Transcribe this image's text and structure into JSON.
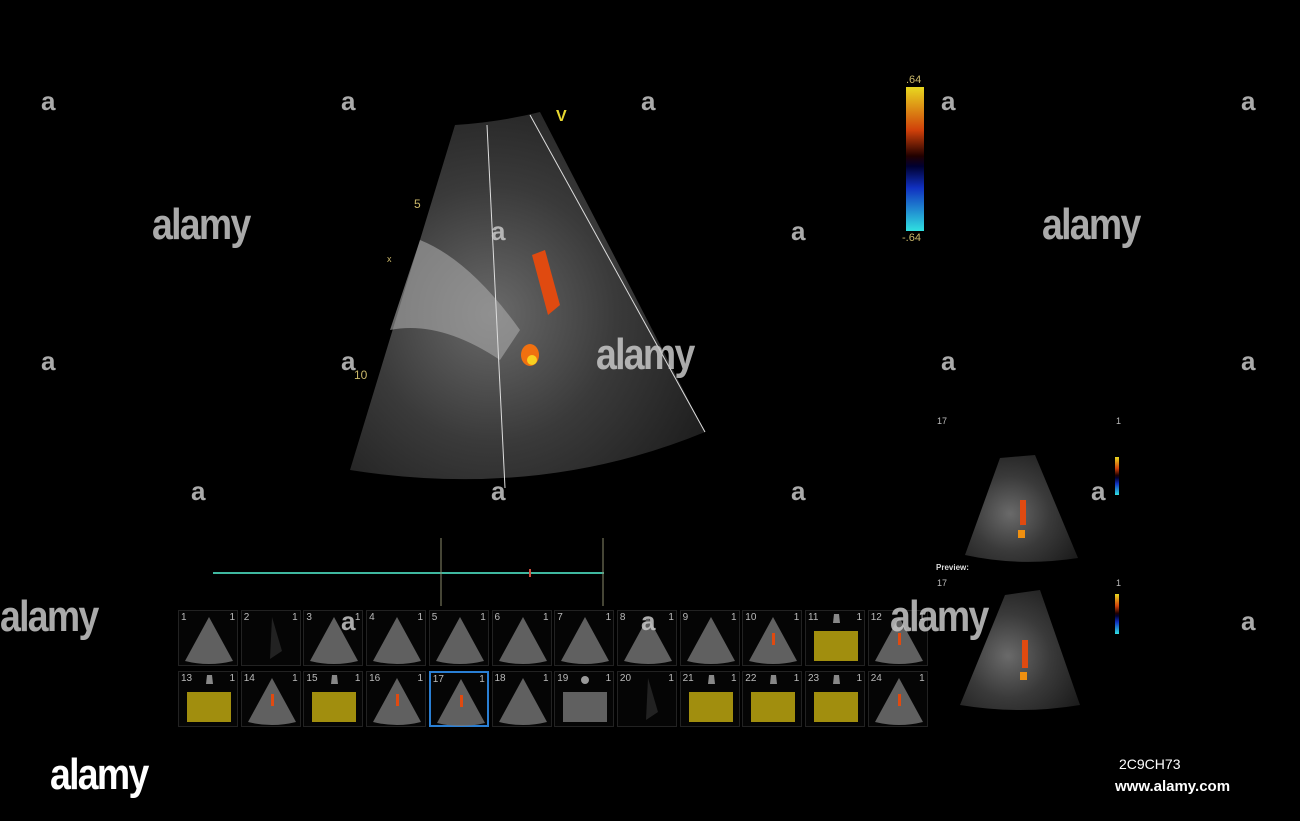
{
  "main_view": {
    "marker": "V",
    "depth_labels": [
      "5",
      "10"
    ],
    "side_marker": "x"
  },
  "color_scale": {
    "max": ".64",
    "min": "-.64"
  },
  "timeline": {
    "track_color": "#3fb8a0"
  },
  "thumbnails": [
    {
      "n": "1",
      "c": "1",
      "type": "echo"
    },
    {
      "n": "2",
      "c": "1",
      "type": "dark"
    },
    {
      "n": "3",
      "c": "1",
      "type": "echo"
    },
    {
      "n": "4",
      "c": "1",
      "type": "echo"
    },
    {
      "n": "5",
      "c": "1",
      "type": "echo"
    },
    {
      "n": "6",
      "c": "1",
      "type": "echo"
    },
    {
      "n": "7",
      "c": "1",
      "type": "echo"
    },
    {
      "n": "8",
      "c": "1",
      "type": "echo"
    },
    {
      "n": "9",
      "c": "1",
      "type": "echo"
    },
    {
      "n": "10",
      "c": "1",
      "type": "color"
    },
    {
      "n": "11",
      "c": "1",
      "type": "doppler"
    },
    {
      "n": "12",
      "c": "1",
      "type": "color"
    },
    {
      "n": "13",
      "c": "1",
      "type": "doppler"
    },
    {
      "n": "14",
      "c": "1",
      "type": "color"
    },
    {
      "n": "15",
      "c": "1",
      "type": "doppler"
    },
    {
      "n": "16",
      "c": "1",
      "type": "color"
    },
    {
      "n": "17",
      "c": "1",
      "type": "color",
      "selected": true
    },
    {
      "n": "18",
      "c": "1",
      "type": "echo"
    },
    {
      "n": "19",
      "c": "1",
      "type": "mmode"
    },
    {
      "n": "20",
      "c": "1",
      "type": "dark"
    },
    {
      "n": "21",
      "c": "1",
      "type": "doppler"
    },
    {
      "n": "22",
      "c": "1",
      "type": "doppler"
    },
    {
      "n": "23",
      "c": "1",
      "type": "doppler"
    },
    {
      "n": "24",
      "c": "1",
      "type": "color"
    }
  ],
  "side_panel": {
    "current_label": "17",
    "current_count": "1",
    "preview_title": "Preview:",
    "preview_label": "17",
    "preview_count": "1"
  },
  "watermark": {
    "text": "alamy",
    "letter": "a"
  },
  "footer": {
    "logo": "alamy",
    "image_id": "2C9CH73",
    "url": "www.alamy.com"
  }
}
